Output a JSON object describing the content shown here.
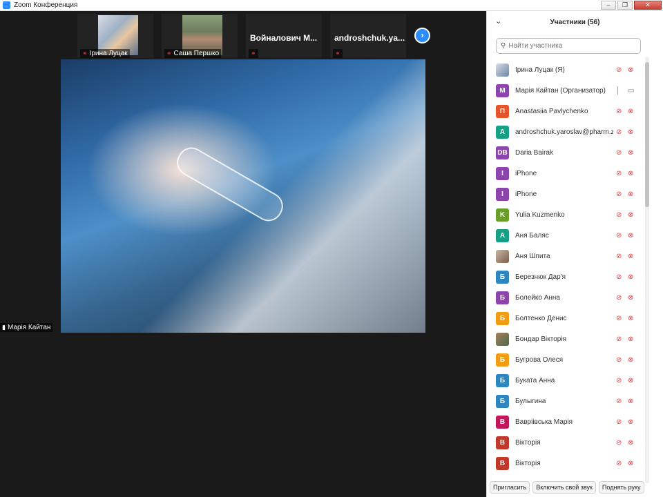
{
  "window": {
    "title": "Zoom Конференция"
  },
  "gallery": [
    {
      "name": "Ірина Луцак",
      "has_photo": true
    },
    {
      "name": "Саша Першко",
      "has_photo": true
    },
    {
      "name": "Войналович  М...",
      "has_photo": false
    },
    {
      "name": "androshchuk.ya...",
      "has_photo": false
    }
  ],
  "main_video": {
    "speaker": "Марія Кайтан"
  },
  "panel": {
    "title": "Участники (56)",
    "search_placeholder": "Найти участника",
    "participants": [
      {
        "name": "Ірина Луцак (Я)",
        "initial": "",
        "color": "photo1",
        "mic": "muted",
        "cam": "off"
      },
      {
        "name": "Марія Кайтан (Организатор)",
        "initial": "M",
        "color": "#8e44ad",
        "mic": "on",
        "cam": "on"
      },
      {
        "name": "Anastasiia Pavlychenko",
        "initial": "П",
        "color": "#e8542a",
        "mic": "muted",
        "cam": "off"
      },
      {
        "name": "androshchuk.yaroslav@pharm.z...",
        "initial": "A",
        "color": "#16a085",
        "mic": "muted",
        "cam": "off"
      },
      {
        "name": "Daria Bairak",
        "initial": "DB",
        "color": "#8e44ad",
        "mic": "muted",
        "cam": "off"
      },
      {
        "name": "iPhone",
        "initial": "I",
        "color": "#8e44ad",
        "mic": "muted",
        "cam": "off"
      },
      {
        "name": "iPhone",
        "initial": "I",
        "color": "#8e44ad",
        "mic": "muted",
        "cam": "off"
      },
      {
        "name": "Yulia Kuzmenko",
        "initial": "K",
        "color": "#6a9e2b",
        "mic": "muted",
        "cam": "off"
      },
      {
        "name": "Аня Баляс",
        "initial": "A",
        "color": "#16a085",
        "mic": "muted",
        "cam": "off"
      },
      {
        "name": "Аня Шпита",
        "initial": "",
        "color": "photo2",
        "mic": "muted",
        "cam": "off"
      },
      {
        "name": "Березнюк Дар'я",
        "initial": "Б",
        "color": "#2e86c1",
        "mic": "muted",
        "cam": "off"
      },
      {
        "name": "Болейко Анна",
        "initial": "Б",
        "color": "#8e44ad",
        "mic": "muted",
        "cam": "off"
      },
      {
        "name": "Болтенко Денис",
        "initial": "Б",
        "color": "#f39c12",
        "mic": "muted",
        "cam": "off"
      },
      {
        "name": "Бондар Вікторія",
        "initial": "",
        "color": "photo3",
        "mic": "muted",
        "cam": "off"
      },
      {
        "name": "Бугрова Олеся",
        "initial": "Б",
        "color": "#f39c12",
        "mic": "muted",
        "cam": "off"
      },
      {
        "name": "Буката Анна",
        "initial": "Б",
        "color": "#2e86c1",
        "mic": "muted",
        "cam": "off"
      },
      {
        "name": "Булыгина",
        "initial": "Б",
        "color": "#2e86c1",
        "mic": "muted",
        "cam": "off"
      },
      {
        "name": "Вавріівська Марія",
        "initial": "В",
        "color": "#c2185b",
        "mic": "muted",
        "cam": "off"
      },
      {
        "name": "Вікторія",
        "initial": "В",
        "color": "#c0392b",
        "mic": "muted",
        "cam": "off"
      },
      {
        "name": "Вікторія",
        "initial": "В",
        "color": "#c0392b",
        "mic": "muted",
        "cam": "off"
      }
    ],
    "buttons": {
      "invite": "Пригласить",
      "unmute": "Включить свой звук",
      "raise_hand": "Поднять руку"
    }
  }
}
